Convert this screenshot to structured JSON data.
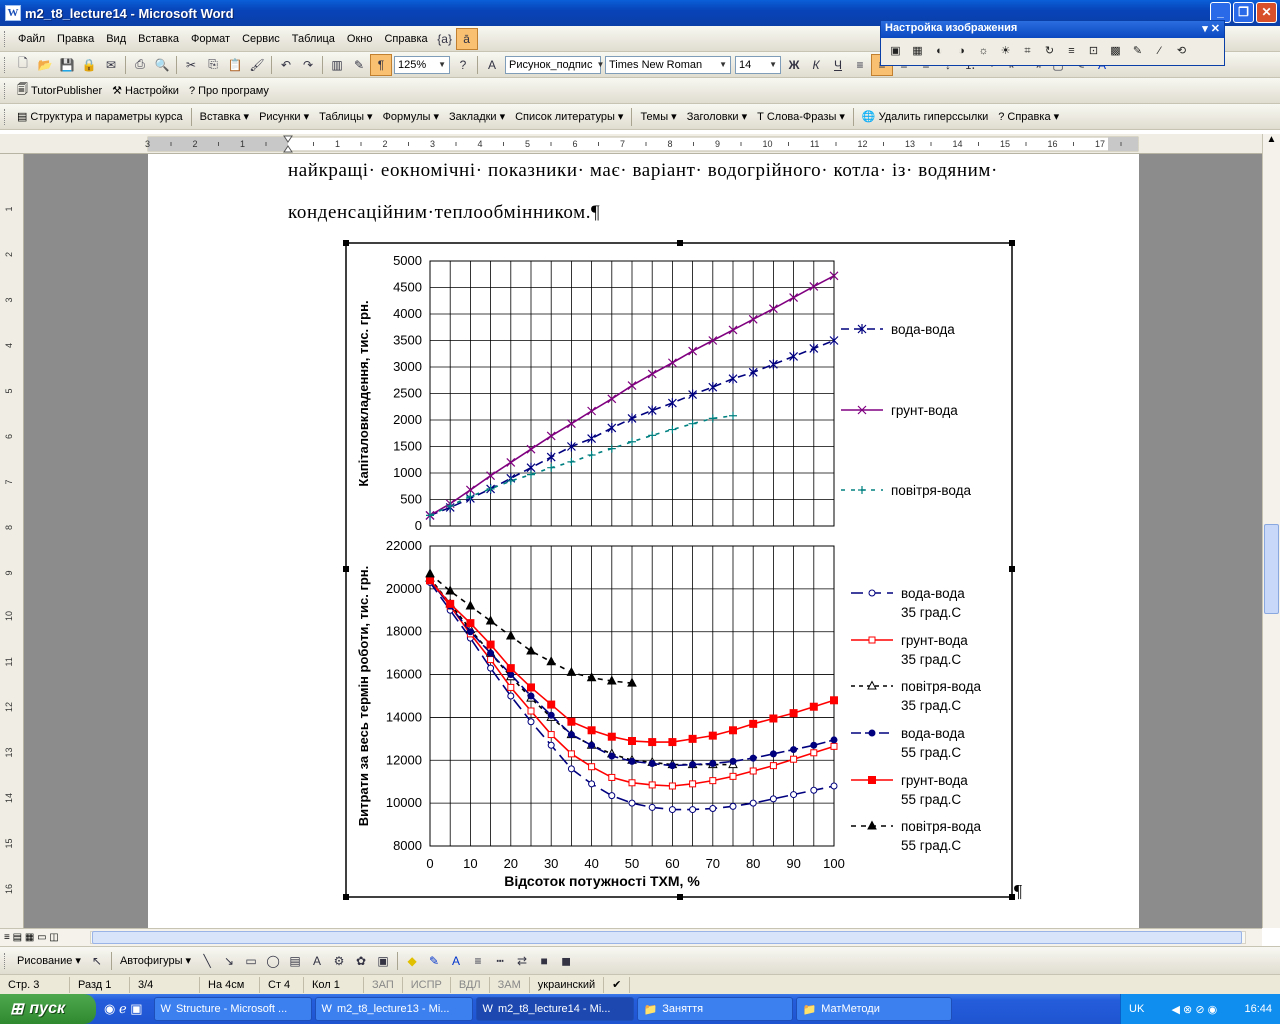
{
  "window": {
    "title": "m2_t8_lecture14 - Microsoft Word"
  },
  "menu": [
    "Файл",
    "Правка",
    "Вид",
    "Вставка",
    "Формат",
    "Сервис",
    "Таблица",
    "Окно",
    "Справка"
  ],
  "format": {
    "zoom": "125%",
    "style": "Рисунок_подпис",
    "font": "Times New Roman",
    "size": "14"
  },
  "tutor_toolbar": [
    "TutorPublisher",
    "Настройки",
    "Про програму"
  ],
  "course_toolbar": [
    "Структура и параметры курса",
    "Вставка",
    "Рисунки",
    "Таблицы",
    "Формулы",
    "Закладки",
    "Список литературы",
    "Темы",
    "Заголовки",
    "Слова-Фразы",
    "Удалить гиперссылки",
    "Справка"
  ],
  "image_panel": {
    "title": "Настройка изображения"
  },
  "document": {
    "line1": "найкращі· еокномічні· показники· має· варіант· водогрійного· котла· із· водяним·",
    "line2": "конденсаційним·теплообмінником.¶",
    "pilcrow": "¶"
  },
  "draw_toolbar": {
    "drawing": "Рисование",
    "autoshapes": "Автофигуры"
  },
  "status": {
    "page": "Стр. 3",
    "section": "Разд 1",
    "pages": "3/4",
    "at": "На 4см",
    "line": "Ст 4",
    "col": "Кол 1",
    "rec": "ЗАП",
    "trk": "ИСПР",
    "ext": "ВДЛ",
    "ovr": "ЗАМ",
    "lang": "украинский"
  },
  "taskbar": {
    "start": "пуск",
    "items": [
      "Structure - Microsoft ...",
      "m2_t8_lecture13 - Mi...",
      "m2_t8_lecture14 - Mi...",
      "Заняття",
      "МатМетоди"
    ],
    "lang": "UK",
    "time": "16:44"
  },
  "colors": {
    "navy": "#00007f",
    "red": "#ff0000",
    "purple": "#800080",
    "teal": "#008080"
  },
  "chart_data": [
    {
      "type": "line",
      "ylabel": "Капіталовкладення, тис. грн.",
      "xlabel": "",
      "ylim": [
        0,
        5000
      ],
      "yticks": [
        0,
        500,
        1000,
        1500,
        2000,
        2500,
        3000,
        3500,
        4000,
        4500,
        5000
      ],
      "xlim": [
        0,
        100
      ],
      "grid": true,
      "legend": "right",
      "series": [
        {
          "name": "вода-вода",
          "color": "#00007f",
          "dash": "8,5",
          "marker": "asterisk",
          "x": [
            0,
            5,
            10,
            15,
            20,
            25,
            30,
            35,
            40,
            45,
            50,
            55,
            60,
            65,
            70,
            75,
            80,
            85,
            90,
            95,
            100
          ],
          "y": [
            200,
            350,
            520,
            700,
            900,
            1100,
            1300,
            1500,
            1650,
            1850,
            2030,
            2180,
            2320,
            2480,
            2620,
            2780,
            2900,
            3050,
            3200,
            3350,
            3500
          ]
        },
        {
          "name": "грунт-вода",
          "color": "#800080",
          "dash": "",
          "marker": "x",
          "x": [
            0,
            5,
            10,
            15,
            20,
            25,
            30,
            35,
            40,
            45,
            50,
            55,
            60,
            65,
            70,
            75,
            80,
            85,
            90,
            95,
            100
          ],
          "y": [
            200,
            420,
            680,
            950,
            1200,
            1450,
            1700,
            1930,
            2170,
            2400,
            2650,
            2870,
            3080,
            3300,
            3500,
            3700,
            3900,
            4100,
            4310,
            4520,
            4720
          ]
        },
        {
          "name": "повітря-вода",
          "color": "#008080",
          "dash": "4,6",
          "marker": "plus",
          "x": [
            0,
            5,
            10,
            15,
            20,
            25,
            30,
            35,
            40,
            45,
            50,
            55,
            60,
            65,
            70,
            75
          ],
          "y": [
            200,
            380,
            560,
            700,
            850,
            970,
            1100,
            1210,
            1340,
            1460,
            1590,
            1710,
            1820,
            1930,
            2030,
            2080
          ]
        }
      ]
    },
    {
      "type": "line",
      "ylabel": "Витрати за весь термін роботи, тис. грн.",
      "xlabel": "Відсоток потужності ТХМ, %",
      "ylim": [
        8000,
        22000
      ],
      "yticks": [
        8000,
        10000,
        12000,
        14000,
        16000,
        18000,
        20000,
        22000
      ],
      "xlim": [
        0,
        100
      ],
      "xticks": [
        0,
        10,
        20,
        30,
        40,
        50,
        60,
        70,
        80,
        90,
        100
      ],
      "grid": true,
      "legend": "right",
      "series": [
        {
          "name": "вода-вода",
          "name2": "35 град.С",
          "color": "#00007f",
          "dash": "12,6",
          "marker": "circle-open",
          "x": [
            0,
            5,
            10,
            15,
            20,
            25,
            30,
            35,
            40,
            45,
            50,
            55,
            60,
            65,
            70,
            75,
            80,
            85,
            90,
            95,
            100
          ],
          "y": [
            20300,
            19000,
            17700,
            16300,
            15000,
            13800,
            12700,
            11600,
            10900,
            10350,
            10000,
            9800,
            9700,
            9700,
            9750,
            9850,
            10000,
            10200,
            10400,
            10600,
            10800
          ]
        },
        {
          "name": "грунт-вода",
          "name2": "35 град.С",
          "color": "#ff0000",
          "dash": "",
          "marker": "square-open",
          "x": [
            0,
            5,
            10,
            15,
            20,
            25,
            30,
            35,
            40,
            45,
            50,
            55,
            60,
            65,
            70,
            75,
            80,
            85,
            90,
            95,
            100
          ],
          "y": [
            20400,
            19200,
            17900,
            16700,
            15400,
            14300,
            13200,
            12300,
            11700,
            11200,
            10950,
            10850,
            10800,
            10900,
            11050,
            11250,
            11500,
            11750,
            12050,
            12350,
            12650
          ]
        },
        {
          "name": "повітря-вода",
          "name2": "35 град.С",
          "color": "#000000",
          "dash": "4,4",
          "marker": "triangle-open",
          "x": [
            0,
            5,
            10,
            15,
            20,
            25,
            30,
            35,
            40,
            45,
            50,
            55,
            60,
            65,
            70,
            75
          ],
          "y": [
            20500,
            19300,
            18100,
            17000,
            15900,
            14900,
            14000,
            13200,
            12700,
            12300,
            12000,
            11900,
            11800,
            11800,
            11800,
            11800
          ]
        },
        {
          "name": "вода-вода",
          "name2": "55 град.С",
          "color": "#00007f",
          "dash": "10,4",
          "marker": "circle-filled",
          "x": [
            0,
            5,
            10,
            15,
            20,
            25,
            30,
            35,
            40,
            45,
            50,
            55,
            60,
            65,
            70,
            75,
            80,
            85,
            90,
            95,
            100
          ],
          "y": [
            20400,
            19200,
            18000,
            17000,
            16000,
            15000,
            14100,
            13200,
            12700,
            12200,
            11950,
            11850,
            11750,
            11800,
            11850,
            11950,
            12100,
            12300,
            12500,
            12700,
            12950
          ]
        },
        {
          "name": "грунт-вода",
          "name2": "55 град.С",
          "color": "#ff0000",
          "dash": "",
          "marker": "square-filled",
          "x": [
            0,
            5,
            10,
            15,
            20,
            25,
            30,
            35,
            40,
            45,
            50,
            55,
            60,
            65,
            70,
            75,
            80,
            85,
            90,
            95,
            100
          ],
          "y": [
            20400,
            19300,
            18400,
            17400,
            16300,
            15400,
            14600,
            13800,
            13400,
            13100,
            12900,
            12850,
            12850,
            13000,
            13150,
            13400,
            13700,
            13950,
            14200,
            14500,
            14800
          ]
        },
        {
          "name": "повітря-вода",
          "name2": "55 град.С",
          "color": "#000000",
          "dash": "5,5",
          "marker": "triangle-filled",
          "x": [
            0,
            5,
            10,
            15,
            20,
            25,
            30,
            35,
            40,
            45,
            50
          ],
          "y": [
            20700,
            19900,
            19200,
            18500,
            17800,
            17100,
            16600,
            16100,
            15850,
            15700,
            15600
          ]
        }
      ]
    }
  ]
}
